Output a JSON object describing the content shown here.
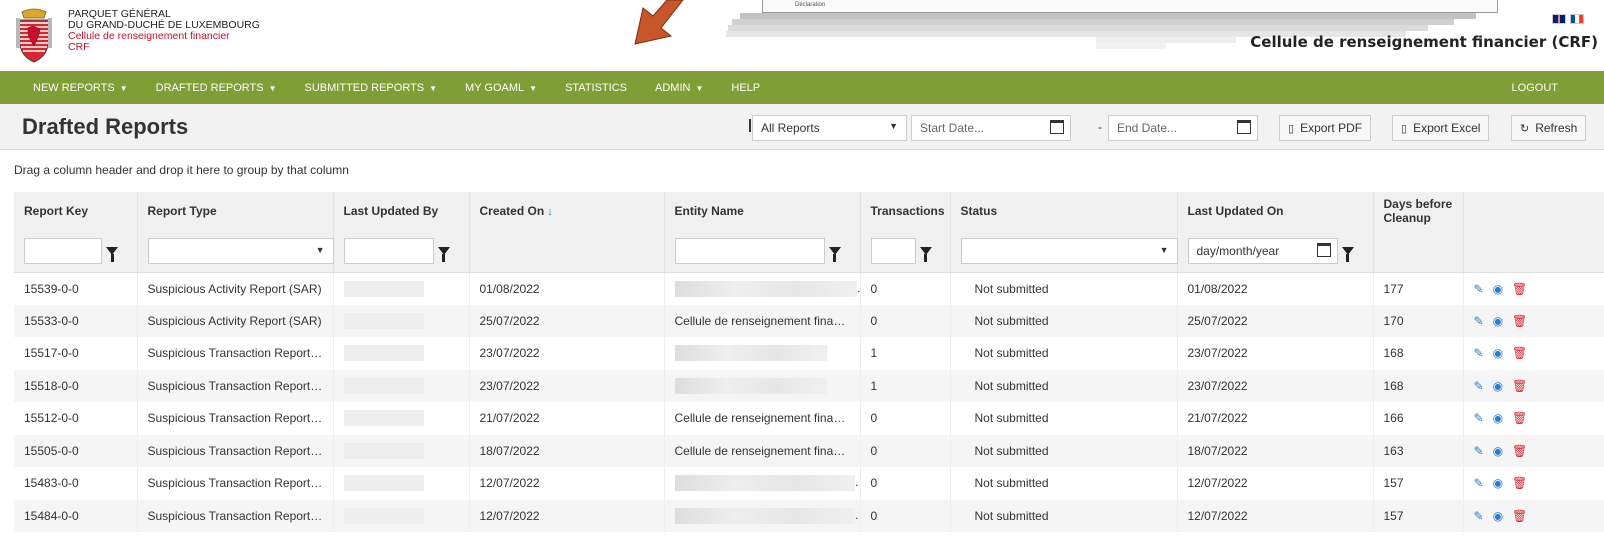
{
  "header": {
    "org_line1": "PARQUET GÉNÉRAL",
    "org_line2": "DU GRAND-DUCHÉ DE LUXEMBOURG",
    "org_line3": "Cellule de renseignement financier",
    "org_line4": "CRF",
    "site_title": "Cellule de renseignement financier (CRF)",
    "overlay_text": "Déclaration",
    "flags": [
      "uk-flag-icon",
      "fr-flag-icon"
    ]
  },
  "nav": {
    "items": [
      {
        "label": "NEW REPORTS",
        "dropdown": true
      },
      {
        "label": "DRAFTED REPORTS",
        "dropdown": true
      },
      {
        "label": "SUBMITTED REPORTS",
        "dropdown": true
      },
      {
        "label": "MY GOAML",
        "dropdown": true
      },
      {
        "label": "STATISTICS",
        "dropdown": false
      },
      {
        "label": "ADMIN",
        "dropdown": true
      },
      {
        "label": "HELP",
        "dropdown": false
      }
    ],
    "logout": "LOGOUT"
  },
  "toolbar": {
    "title": "Drafted Reports",
    "filter_value": "All Reports",
    "start_placeholder": "Start Date...",
    "end_placeholder": "End Date...",
    "dash": "-",
    "export_pdf": "Export PDF",
    "export_excel": "Export Excel",
    "refresh": "Refresh"
  },
  "grid": {
    "group_hint": "Drag a column header and drop it here to group by that column",
    "columns": [
      "Report Key",
      "Report Type",
      "Last Updated By",
      "Created On",
      "Entity Name",
      "Transactions",
      "Status",
      "Last Updated On",
      "Days before Cleanup",
      ""
    ],
    "date_filter_placeholder": "day/month/year",
    "rows": [
      {
        "key": "15539-0-0",
        "type": "Suspicious Activity Report (SAR)",
        "created": "01/08/2022",
        "entity": "",
        "transactions": "0",
        "status": "Not submitted",
        "updated": "01/08/2022",
        "days": "177"
      },
      {
        "key": "15533-0-0",
        "type": "Suspicious Activity Report (SAR)",
        "created": "25/07/2022",
        "entity": "Cellule de renseignement finan...",
        "transactions": "0",
        "status": "Not submitted",
        "updated": "25/07/2022",
        "days": "170"
      },
      {
        "key": "15517-0-0",
        "type": "Suspicious Transaction Report (...",
        "created": "23/07/2022",
        "entity": "",
        "transactions": "1",
        "status": "Not submitted",
        "updated": "23/07/2022",
        "days": "168"
      },
      {
        "key": "15518-0-0",
        "type": "Suspicious Transaction Report (...",
        "created": "23/07/2022",
        "entity": "",
        "transactions": "1",
        "status": "Not submitted",
        "updated": "23/07/2022",
        "days": "168"
      },
      {
        "key": "15512-0-0",
        "type": "Suspicious Transaction Report (...",
        "created": "21/07/2022",
        "entity": "Cellule de renseignement finan...",
        "transactions": "0",
        "status": "Not submitted",
        "updated": "21/07/2022",
        "days": "166"
      },
      {
        "key": "15505-0-0",
        "type": "Suspicious Transaction Report (...",
        "created": "18/07/2022",
        "entity": "Cellule de renseignement finan...",
        "transactions": "0",
        "status": "Not submitted",
        "updated": "18/07/2022",
        "days": "163"
      },
      {
        "key": "15483-0-0",
        "type": "Suspicious Transaction Report (...",
        "created": "12/07/2022",
        "entity": "",
        "transactions": "0",
        "status": "Not submitted",
        "updated": "12/07/2022",
        "days": "157"
      },
      {
        "key": "15484-0-0",
        "type": "Suspicious Transaction Report (...",
        "created": "12/07/2022",
        "entity": "",
        "transactions": "0",
        "status": "Not submitted",
        "updated": "12/07/2022",
        "days": "157"
      }
    ]
  },
  "colors": {
    "nav_bg": "#7e9f35",
    "accent_red": "#c8102e",
    "action_blue": "#2a7bd6",
    "delete_red": "#d9282f",
    "arrow_orange": "#c8562b"
  }
}
